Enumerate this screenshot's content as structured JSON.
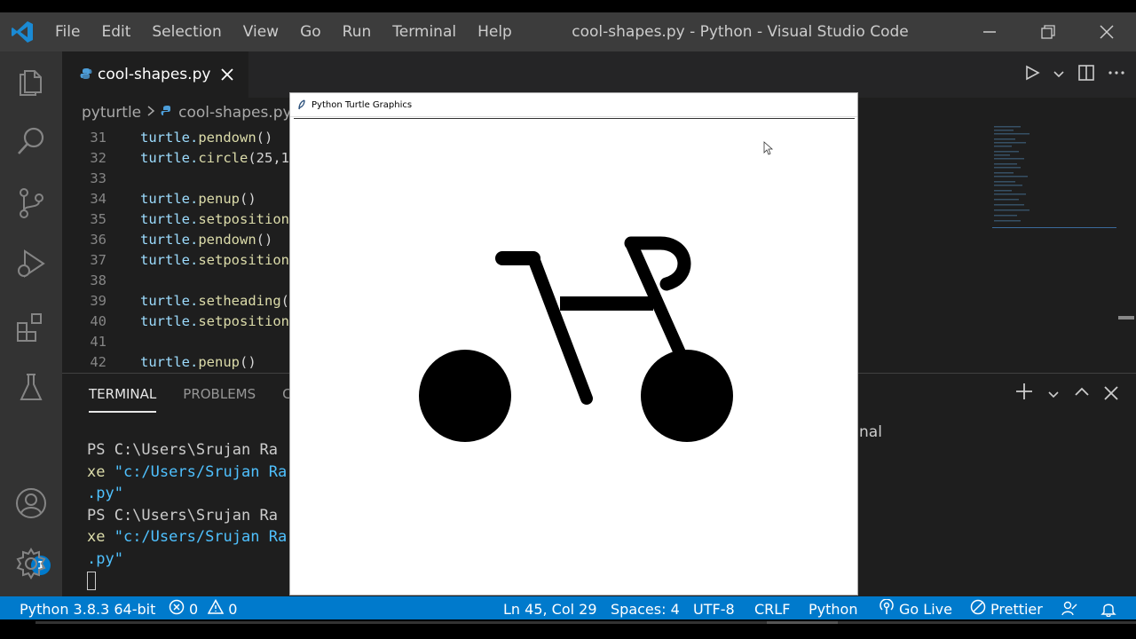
{
  "window": {
    "title": "cool-shapes.py - Python - Visual Studio Code",
    "controls": [
      "minimize",
      "restore",
      "close"
    ]
  },
  "menu": [
    "File",
    "Edit",
    "Selection",
    "View",
    "Go",
    "Run",
    "Terminal",
    "Help"
  ],
  "activity_bar": {
    "items": [
      "explorer-icon",
      "search-icon",
      "source-control-icon",
      "run-debug-icon",
      "extensions-icon",
      "testing-icon"
    ],
    "bottom": [
      "accounts-icon",
      "settings-gear-icon"
    ],
    "accounts_badge": "1"
  },
  "editor": {
    "tab": {
      "label": "cool-shapes.py",
      "icon": "python-icon"
    },
    "breadcrumb": [
      "pyturtle",
      "cool-shapes.py"
    ],
    "lines": [
      {
        "num": "31",
        "text": "turtle.pendown()"
      },
      {
        "num": "32",
        "text": "turtle.circle(25,1"
      },
      {
        "num": "33",
        "text": ""
      },
      {
        "num": "34",
        "text": "turtle.penup()"
      },
      {
        "num": "35",
        "text": "turtle.setposition"
      },
      {
        "num": "36",
        "text": "turtle.pendown()"
      },
      {
        "num": "37",
        "text": "turtle.setposition"
      },
      {
        "num": "38",
        "text": ""
      },
      {
        "num": "39",
        "text": "turtle.setheading("
      },
      {
        "num": "40",
        "text": "turtle.setposition"
      },
      {
        "num": "41",
        "text": ""
      },
      {
        "num": "42",
        "text": "turtle.penup()"
      }
    ]
  },
  "panel": {
    "tabs": [
      "TERMINAL",
      "PROBLEMS",
      "C"
    ],
    "active_tab": "TERMINAL",
    "terminal_selector": "nal",
    "terminal_lines": [
      {
        "prompt": "PS C:\\Users\\Srujan Ra"
      },
      {
        "kw": "xe ",
        "str": "\"c:/Users/Srujan Ra"
      },
      {
        "str": ".py\""
      },
      {
        "prompt": "PS C:\\Users\\Srujan Ra"
      },
      {
        "kw": "xe ",
        "str": "\"c:/Users/Srujan Ra"
      },
      {
        "str": ".py\""
      }
    ]
  },
  "turtle_window": {
    "title": "Python Turtle Graphics"
  },
  "status_bar": {
    "interpreter": "Python 3.8.3 64-bit",
    "errors": "0",
    "warnings": "0",
    "cursor": "Ln 45, Col 29",
    "spaces": "Spaces: 4",
    "encoding": "UTF-8",
    "eol": "CRLF",
    "language": "Python",
    "go_live": "Go Live",
    "prettier": "Prettier"
  },
  "colors": {
    "titlebar": "#3c3c3c",
    "activitybar": "#333333",
    "editor_bg": "#1e1e1e",
    "statusbar": "#007acc",
    "code_identifier": "#9cdcfe",
    "code_function": "#dcdcaa",
    "terminal_string": "#4fc1ff"
  }
}
